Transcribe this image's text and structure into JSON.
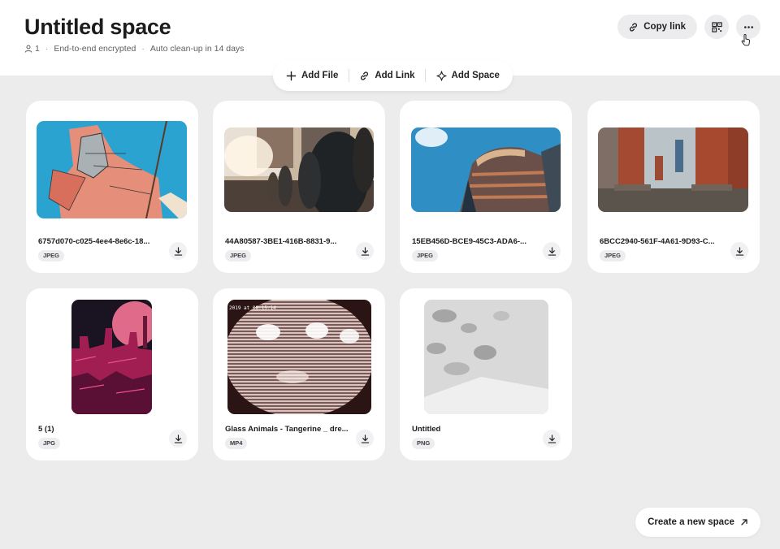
{
  "space": {
    "title": "Untitled space",
    "member_count": "1",
    "encryption": "End-to-end encrypted",
    "cleanup": "Auto clean-up in 14 days"
  },
  "top_actions": {
    "copy_link": "Copy link",
    "qr_icon": "qr-code-icon",
    "more_icon": "more-horizontal-icon"
  },
  "add_bar": {
    "file": "Add File",
    "link": "Add Link",
    "space": "Add Space"
  },
  "files": [
    {
      "name": "6757d070-c025-4ee4-8e6c-18...",
      "type": "JPEG"
    },
    {
      "name": "44A80587-3BE1-416B-8831-9...",
      "type": "JPEG"
    },
    {
      "name": "15EB456D-BCE9-45C3-ADA6-...",
      "type": "JPEG"
    },
    {
      "name": "6BCC2940-561F-4A61-9D93-C...",
      "type": "JPEG"
    },
    {
      "name": "5 (1)",
      "type": "JPG"
    },
    {
      "name": "Glass Animals - Tangerine _ dre...",
      "type": "MP4",
      "overlay": "2019 at 08:15:14"
    },
    {
      "name": "Untitled",
      "type": "PNG"
    }
  ],
  "create_space": "Create a new space",
  "colors": {
    "background": "#ececed",
    "card": "#ffffff",
    "badge": "#ededef"
  }
}
